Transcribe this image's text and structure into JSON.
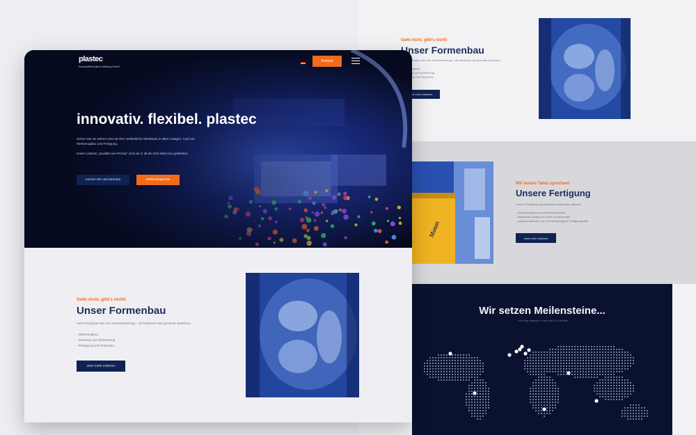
{
  "back": {
    "formenbau": {
      "eyebrow": "Geht nicht, gibt's nicht!",
      "title": "Unser Formenbau",
      "subtitle": "Vom Prototypen bis zum Serienwerkzeug – wir bedienen das gesamte Spektrum.",
      "items": [
        "- Werkzeugbau",
        "- Wartung und Optimierung",
        "- Reinigung und Reparatur"
      ],
      "button": "Jetzt mehr erfahren"
    },
    "fertigung": {
      "eyebrow": "Wir lassen Taten sprechen!",
      "title": "Unsere Fertigung",
      "subtitle": "Unsere Fertigung wird jeglichen Ansprüchen gerecht.",
      "items": [
        "- Serienspritzguss und Serienproduktion",
        "- Modernste Anlagen für Zwei-Komponenten",
        "- vollautomatisierte und reinraumgeeignete Fertigungszelle"
      ],
      "button": "Jetzt mehr erfahren",
      "machine_brand": "Motan"
    },
    "map": {
      "title": "Wir setzen Meilensteine...",
      "subtitle": "... und das weltweit in mehr als 50 Ländern."
    }
  },
  "front": {
    "header": {
      "logo": "plastec",
      "logo_sub": "Kunststofftechnikum Weilburg GmbH",
      "contact_button": "Kontakt",
      "lang_icon": "flag-de-icon",
      "menu_icon": "hamburger-menu-icon"
    },
    "hero": {
      "title": "innovativ. flexibel. plastec",
      "p1": "Schon seit 25 Jahren sind wir Ihre verlässliche Werkbank in allen Anlagen, rund um Werkzeugbau und Fertigung.",
      "p2": "Unser Leitsatz „Qualität aus Prinzip\" sind wir in all der Zeit stets treu geblieben.",
      "btn_primary": "Lernen Sie uns kennen!",
      "btn_secondary": "Stellenangebote"
    },
    "formenbau": {
      "eyebrow": "Geht nicht, gibt's nicht!",
      "title": "Unser Formenbau",
      "subtitle": "Vom Prototypen bis zum Serienwerkzeug – wir bedienen das gesamte Spektrum.",
      "items": [
        "- Werkzeugbau",
        "- Wartung und Optimierung",
        "- Reinigung und Reparatur"
      ],
      "button": "Jetzt mehr erfahren"
    }
  },
  "colors": {
    "accent": "#f26a1b",
    "navy": "#0f2352",
    "title": "#1c2d5a",
    "hero_bg": "#070a1f"
  }
}
